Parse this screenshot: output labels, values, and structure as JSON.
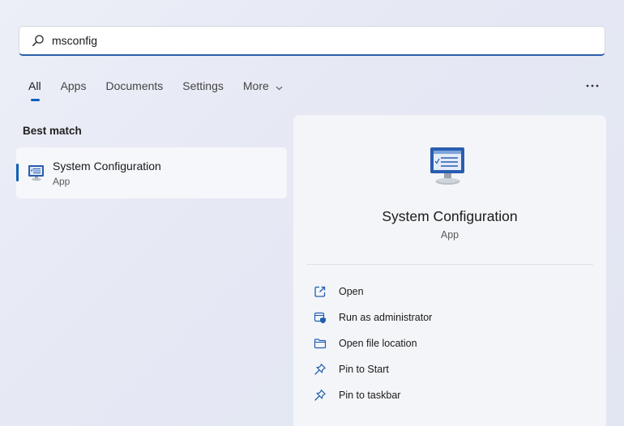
{
  "search": {
    "value": "msconfig",
    "icon": "search-icon"
  },
  "tabs": [
    {
      "label": "All",
      "active": true
    },
    {
      "label": "Apps",
      "active": false
    },
    {
      "label": "Documents",
      "active": false
    },
    {
      "label": "Settings",
      "active": false
    },
    {
      "label": "More",
      "active": false,
      "icon": "chevron-down-icon"
    }
  ],
  "more_options": {
    "icon": "more-options-icon"
  },
  "best_match": {
    "heading": "Best match",
    "item": {
      "title": "System Configuration",
      "subtitle": "App",
      "icon": "system-configuration-icon"
    }
  },
  "detail": {
    "title": "System Configuration",
    "subtitle": "App",
    "icon": "system-configuration-icon",
    "actions": [
      {
        "label": "Open",
        "icon": "open-icon"
      },
      {
        "label": "Run as administrator",
        "icon": "shield-icon"
      },
      {
        "label": "Open file location",
        "icon": "folder-icon"
      },
      {
        "label": "Pin to Start",
        "icon": "pin-icon"
      },
      {
        "label": "Pin to taskbar",
        "icon": "pin-icon"
      }
    ]
  },
  "colors": {
    "accent": "#0f5fb8",
    "icon_blue": "#2b6cc4"
  }
}
